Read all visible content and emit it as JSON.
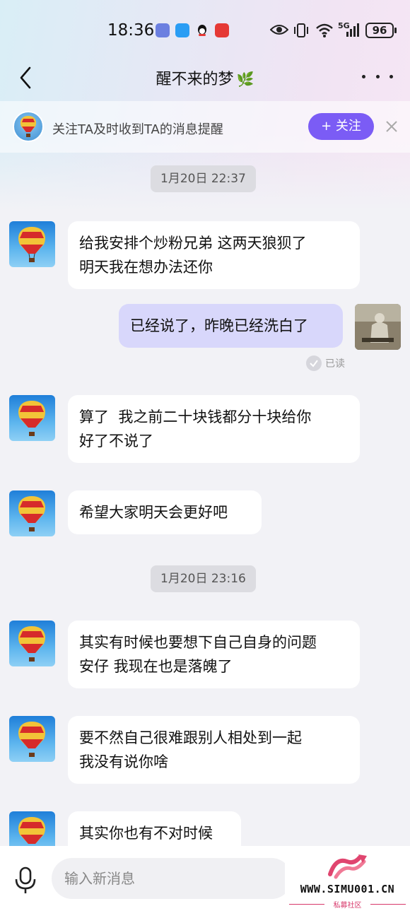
{
  "status_bar": {
    "time": "18:36",
    "network": "5G",
    "battery": "96"
  },
  "header": {
    "title": "醒不来的梦",
    "title_emoji": "🌿"
  },
  "follow_bar": {
    "text": "关注TA及时收到TA的消息提醒",
    "button_label": "+ 关注"
  },
  "timestamps": [
    "1月20日 22:37",
    "1月20日 23:16"
  ],
  "messages": [
    {
      "sender": "other",
      "lines": [
        "给我安排个炒粉兄弟 这两天狼狈了",
        "明天我在想办法还你"
      ]
    },
    {
      "sender": "me",
      "lines": [
        "已经说了，昨晚已经洗白了"
      ],
      "read_label": "已读"
    },
    {
      "sender": "other",
      "lines": [
        "算了  我之前二十块钱都分十块给你",
        "好了不说了"
      ]
    },
    {
      "sender": "other",
      "lines": [
        "希望大家明天会更好吧"
      ]
    },
    {
      "sender": "other",
      "lines": [
        "其实有时候也要想下自己自身的问题",
        "安仔 我现在也是落魄了"
      ]
    },
    {
      "sender": "other",
      "lines": [
        "要不然自己很难跟别人相处到一起",
        "我没有说你啥"
      ]
    },
    {
      "sender": "other",
      "lines": [
        "其实你也有不对时候"
      ]
    }
  ],
  "input": {
    "placeholder": "输入新消息"
  },
  "watermark": {
    "url": "WWW.SIMU001.CN",
    "subtitle": "私募社区"
  },
  "colors": {
    "accent": "#7b5cf5",
    "my_bubble": "#d8d7fb",
    "background": "#f2f2f6"
  }
}
